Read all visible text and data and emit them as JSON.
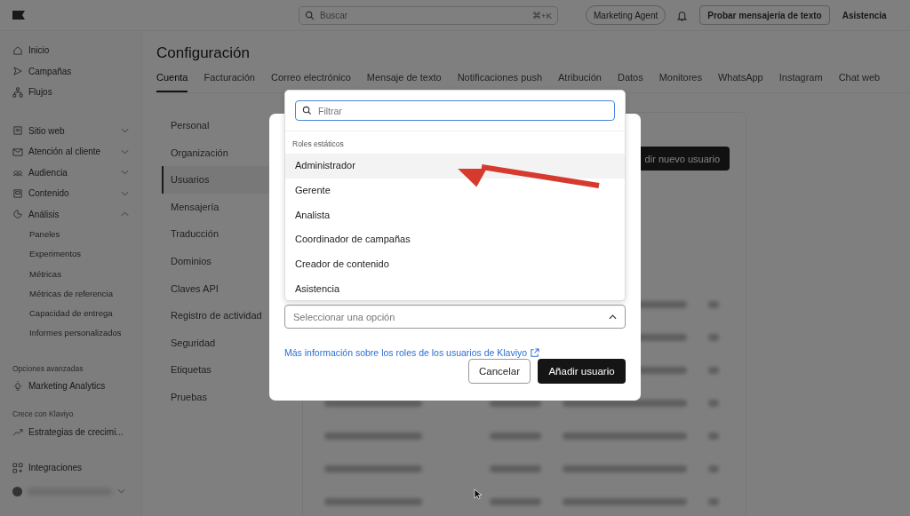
{
  "topbar": {
    "search": {
      "placeholder": "Buscar",
      "shortcut": "⌘+K"
    },
    "agent": "Marketing Agent",
    "try_button": "Probar mensajería de texto",
    "help": "Asistencia"
  },
  "sidebar": {
    "main": [
      {
        "label": "Inicio"
      },
      {
        "label": "Campañas"
      },
      {
        "label": "Flujos"
      }
    ],
    "nav": [
      {
        "label": "Sitio web",
        "expanded": false
      },
      {
        "label": "Atención al cliente",
        "expanded": false
      },
      {
        "label": "Audiencia",
        "expanded": false
      },
      {
        "label": "Contenido",
        "expanded": false
      },
      {
        "label": "Análisis",
        "expanded": true,
        "children": [
          {
            "label": "Paneles"
          },
          {
            "label": "Experimentos"
          },
          {
            "label": "Métricas"
          },
          {
            "label": "Métricas de referencia"
          },
          {
            "label": "Capacidad de entrega"
          },
          {
            "label": "Informes personalizados"
          }
        ]
      }
    ],
    "sections": [
      {
        "title": "Opciones avanzadas",
        "items": [
          {
            "label": "Marketing Analytics"
          }
        ]
      },
      {
        "title": "Crece con Klaviyo",
        "items": [
          {
            "label": "Estrategias de crecimi..."
          }
        ]
      }
    ],
    "bottom": [
      {
        "label": "Integraciones"
      }
    ]
  },
  "page": {
    "title": "Configuración",
    "tabs": [
      {
        "label": "Cuenta",
        "selected": true
      },
      {
        "label": "Facturación",
        "selected": false
      },
      {
        "label": "Correo electrónico",
        "selected": false
      },
      {
        "label": "Mensaje de texto",
        "selected": false
      },
      {
        "label": "Notificaciones push",
        "selected": false
      },
      {
        "label": "Atribución",
        "selected": false
      },
      {
        "label": "Datos",
        "selected": false
      },
      {
        "label": "Monitores",
        "selected": false
      },
      {
        "label": "WhatsApp",
        "selected": false
      },
      {
        "label": "Instagram",
        "selected": false
      },
      {
        "label": "Chat web",
        "selected": false
      }
    ],
    "subnav": [
      {
        "label": "Personal",
        "selected": false
      },
      {
        "label": "Organización",
        "selected": false
      },
      {
        "label": "Usuarios",
        "selected": true
      },
      {
        "label": "Mensajería",
        "selected": false
      },
      {
        "label": "Traducción",
        "selected": false
      },
      {
        "label": "Dominios",
        "selected": false
      },
      {
        "label": "Claves API",
        "selected": false
      },
      {
        "label": "Registro de actividad",
        "selected": false
      },
      {
        "label": "Seguridad",
        "selected": false
      },
      {
        "label": "Etiquetas",
        "selected": false
      },
      {
        "label": "Pruebas",
        "selected": false
      }
    ],
    "add_button": "dir nuevo usuario"
  },
  "modal": {
    "role_select": {
      "placeholder": "Seleccionar una opción"
    },
    "dropdown": {
      "filter_placeholder": "Filtrar",
      "group": "Roles estáticos",
      "options": [
        {
          "label": "Administrador",
          "selected": true
        },
        {
          "label": "Gerente",
          "selected": false
        },
        {
          "label": "Analista",
          "selected": false
        },
        {
          "label": "Coordinador de campañas",
          "selected": false
        },
        {
          "label": "Creador de contenido",
          "selected": false
        },
        {
          "label": "Asistencia",
          "selected": false
        }
      ]
    },
    "link": "Más información sobre los roles de los usuarios de Klaviyo",
    "cancel": "Cancelar",
    "submit": "Añadir usuario"
  }
}
